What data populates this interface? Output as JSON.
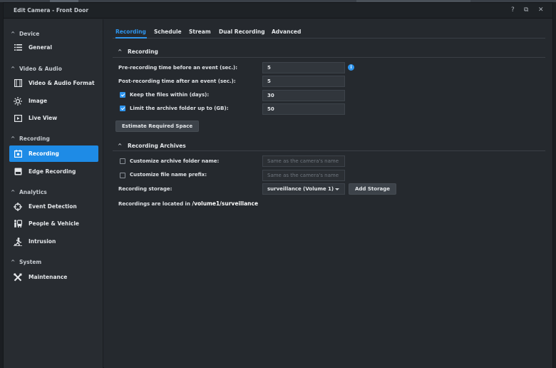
{
  "window": {
    "title": "Edit Camera - Front Door",
    "help": "?",
    "restore": "⧉",
    "close": "✕"
  },
  "sidebar": {
    "sections": [
      {
        "label": "Device"
      },
      {
        "label": "Video & Audio"
      },
      {
        "label": "Recording"
      },
      {
        "label": "Analytics"
      },
      {
        "label": "System"
      }
    ],
    "items": [
      {
        "label": "General",
        "icon": "list-icon"
      },
      {
        "label": "Video & Audio Format",
        "icon": "film-icon"
      },
      {
        "label": "Image",
        "icon": "sun-icon"
      },
      {
        "label": "Live View",
        "icon": "play-icon"
      },
      {
        "label": "Recording",
        "icon": "recording-icon",
        "active": true
      },
      {
        "label": "Edge Recording",
        "icon": "sd-card-icon"
      },
      {
        "label": "Event Detection",
        "icon": "crosshair-icon"
      },
      {
        "label": "People & Vehicle",
        "icon": "people-icon"
      },
      {
        "label": "Intrusion",
        "icon": "runner-icon"
      },
      {
        "label": "Maintenance",
        "icon": "tools-icon"
      }
    ]
  },
  "tabs": [
    {
      "label": "Recording",
      "active": true
    },
    {
      "label": "Schedule"
    },
    {
      "label": "Stream"
    },
    {
      "label": "Dual Recording"
    },
    {
      "label": "Advanced"
    }
  ],
  "recording": {
    "heading": "Recording",
    "pre_label": "Pre-recording time before an event (sec.):",
    "pre_value": "5",
    "post_label": "Post-recording time after an event (sec.):",
    "post_value": "5",
    "keep_label": "Keep the files within (days):",
    "keep_checked": true,
    "keep_value": "30",
    "limit_label": "Limit the archive folder up to (GB):",
    "limit_checked": true,
    "limit_value": "50",
    "estimate_button": "Estimate Required Space"
  },
  "archives": {
    "heading": "Recording Archives",
    "folder_label": "Customize archive folder name:",
    "folder_checked": false,
    "folder_placeholder": "Same as the camera's name",
    "prefix_label": "Customize file name prefix:",
    "prefix_checked": false,
    "prefix_placeholder": "Same as the camera's name",
    "storage_label": "Recording storage:",
    "storage_value": "surveillance (Volume 1)",
    "add_storage_button": "Add Storage",
    "location_prefix": "Recordings are located in",
    "location_path": "/volume1/surveillance"
  },
  "colors": {
    "accent": "#1e8be6",
    "background": "#25292e",
    "sidebar": "#282c31"
  }
}
